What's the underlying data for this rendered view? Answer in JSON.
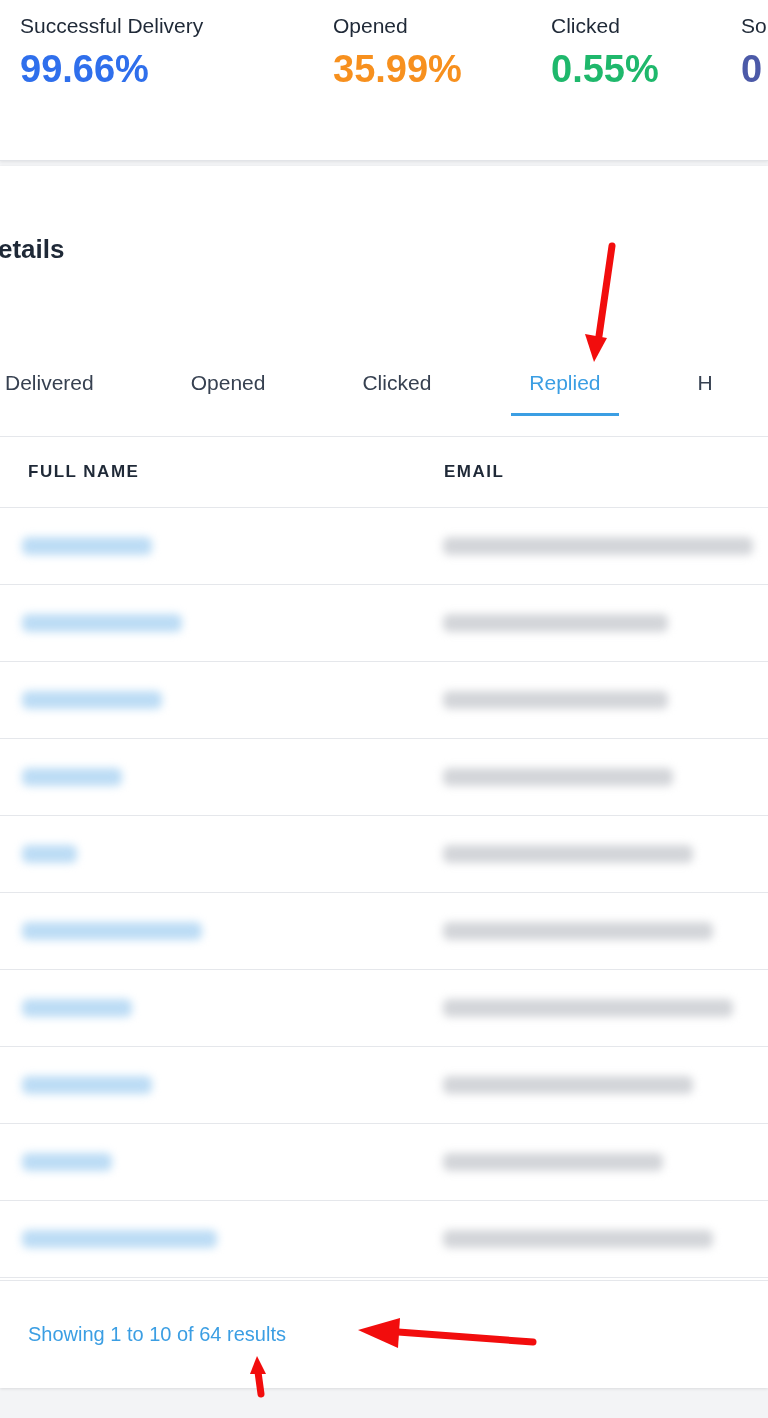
{
  "stats": [
    {
      "label": "Successful Delivery",
      "value": "99.66%",
      "color": "#2f6fec"
    },
    {
      "label": "Opened",
      "value": "35.99%",
      "color": "#f7901e"
    },
    {
      "label": "Clicked",
      "value": "0.55%",
      "color": "#1fb86c"
    },
    {
      "label": "So",
      "value": "0",
      "color": "#4c5aa8"
    }
  ],
  "details": {
    "title": "etails",
    "tabs": [
      {
        "label": "Delivered",
        "selected": false
      },
      {
        "label": "Opened",
        "selected": false
      },
      {
        "label": "Clicked",
        "selected": false
      },
      {
        "label": "Replied",
        "selected": true
      },
      {
        "label": "H",
        "selected": false
      }
    ],
    "table": {
      "columns": [
        "FULL NAME",
        "EMAIL"
      ],
      "rows": [
        {
          "kind": "redacted"
        },
        {
          "kind": "redacted"
        },
        {
          "kind": "redacted"
        },
        {
          "kind": "redacted"
        },
        {
          "kind": "redacted"
        },
        {
          "kind": "redacted"
        },
        {
          "kind": "redacted"
        },
        {
          "kind": "redacted"
        },
        {
          "kind": "redacted"
        },
        {
          "kind": "redacted"
        }
      ]
    },
    "footer": "Showing 1 to 10 of 64 results"
  },
  "annotations": [
    {
      "kind": "arrow-down"
    },
    {
      "kind": "arrow-left"
    },
    {
      "kind": "arrow-up"
    }
  ]
}
